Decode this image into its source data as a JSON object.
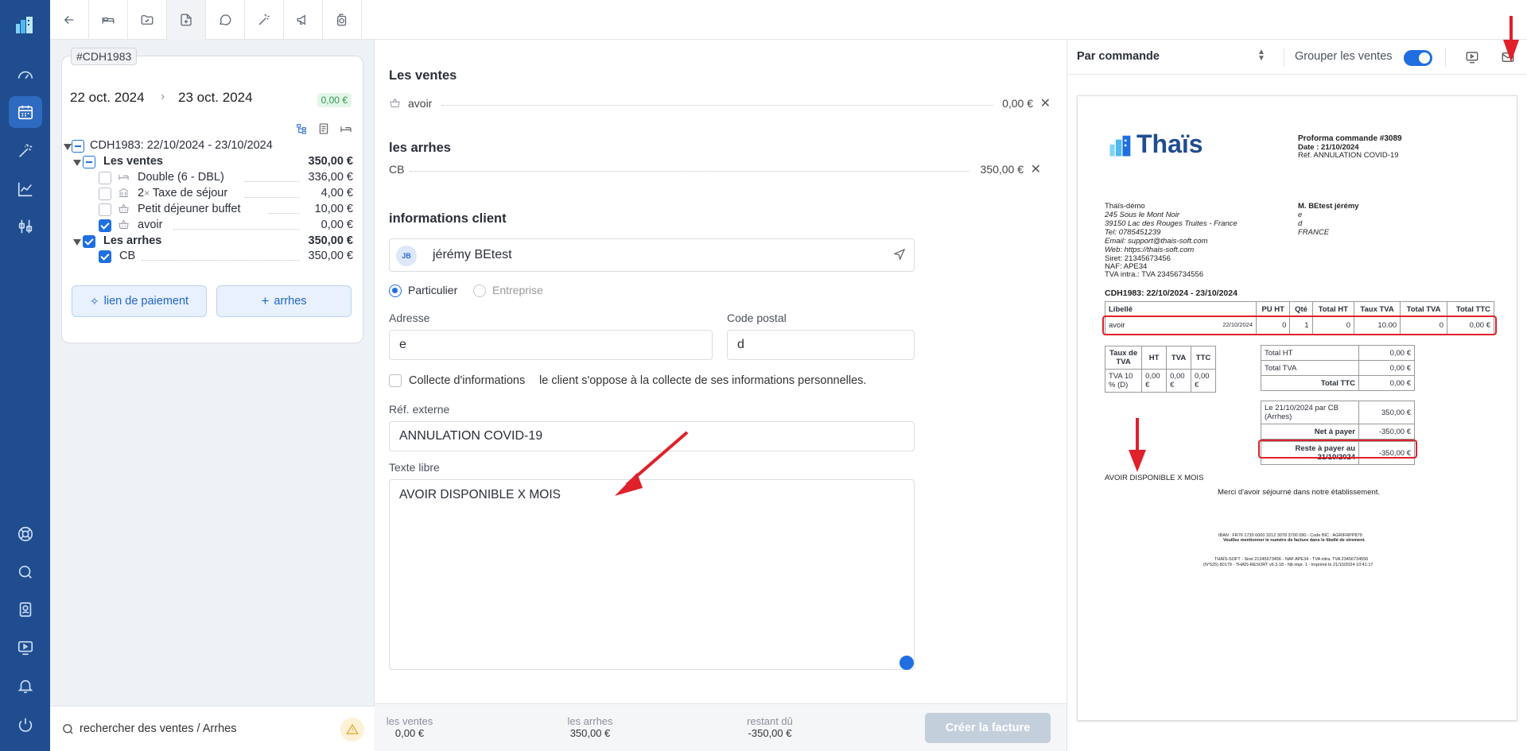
{
  "topbar": {
    "icons": [
      "back-arrow-icon",
      "bed-icon",
      "folder-open-icon",
      "document-plus-icon",
      "chat-icon",
      "magic-wand-icon",
      "megaphone-icon",
      "camera-icon"
    ]
  },
  "booking": {
    "id": "#CDH1983",
    "date_start": "22 oct. 2024",
    "date_end": "23 oct. 2024",
    "balance": "0,00 €"
  },
  "tree": {
    "root": "CDH1983: 22/10/2024 - 23/10/2024",
    "ventes": {
      "label": "Les ventes",
      "total": "350,00 €",
      "items": [
        {
          "label": "Double (6 - DBL)",
          "value": "336,00 €",
          "checked": false
        },
        {
          "qty": "2",
          "mult": "×",
          "label": "Taxe de séjour",
          "value": "4,00 €",
          "checked": false
        },
        {
          "label": "Petit déjeuner buffet",
          "value": "10,00 €",
          "checked": false
        },
        {
          "label": "avoir",
          "value": "0,00 €",
          "checked": true
        }
      ]
    },
    "arrhes": {
      "label": "Les arrhes",
      "total": "350,00 €",
      "items": [
        {
          "label": "CB",
          "value": "350,00 €",
          "checked": true
        }
      ]
    }
  },
  "buttons": {
    "payment_link": "lien de paiement",
    "add_arrhes": "arrhes",
    "create_invoice": "Créer la facture"
  },
  "search": {
    "placeholder": "rechercher des ventes / Arrhes"
  },
  "middle": {
    "ventes_title": "Les ventes",
    "vente_item": "avoir",
    "vente_value": "0,00 €",
    "arrhes_title": "les arrhes",
    "arrhes_item": "CB",
    "arrhes_value": "350,00 €",
    "client_title": "informations client",
    "client_initials": "JB",
    "client_name": "jérémy BEtest",
    "radio_particulier": "Particulier",
    "radio_entreprise": "Entreprise",
    "address_label": "Adresse",
    "address_value": "e",
    "postal_label": "Code postal",
    "postal_value": "d",
    "collect_label": "Collecte d'informations",
    "collect_text": "le client s'oppose à la collecte de ses informations personnelles.",
    "ref_label": "Réf. externe",
    "ref_value": "ANNULATION COVID-19",
    "free_label": "Texte libre",
    "free_value": "AVOIR DISPONIBLE X MOIS"
  },
  "footer": {
    "ventes_label": "les ventes",
    "ventes_value": "0,00 €",
    "arrhes_label": "les arrhes",
    "arrhes_value": "350,00 €",
    "due_label": "restant dû",
    "due_value": "-350,00 €"
  },
  "right": {
    "mode": "Par commande",
    "group_label": "Grouper les ventes",
    "group_on": true
  },
  "doc": {
    "logo": "Thaïs",
    "title": "Proforma commande #3089",
    "date": "Date : 21/10/2024",
    "ref": "Réf. ANNULATION COVID-19",
    "company": [
      "Thaïs-démo",
      "245 Sous le Mont Noir",
      "39150 Lac des Rouges Truites - France",
      "Tel: 0785451239",
      "Email: support@thais-soft.com",
      "Web: https://thais-soft.com",
      "Siret: 21345673456",
      "NAF: APE34",
      "TVA intra.: TVA 23456734556"
    ],
    "client": [
      "M. BEtest jérémy",
      "e",
      "d",
      "FRANCE"
    ],
    "booking_line": "CDH1983: 22/10/2024 - 23/10/2024",
    "table_headers": [
      "Libellé",
      "PU HT",
      "Qté",
      "Total HT",
      "Taux TVA",
      "Total TVA",
      "Total TTC"
    ],
    "table_row": {
      "label": "avoir",
      "date": "22/10/2024",
      "pu": "0",
      "qty": "1",
      "total_ht": "0",
      "rate": "10.00",
      "tva": "0",
      "ttc": "0,00 €"
    },
    "vat_headers": [
      "Taux de TVA",
      "HT",
      "TVA",
      "TTC"
    ],
    "vat_row": [
      "TVA 10 % (D)",
      "0,00 €",
      "0,00 €",
      "0,00 €"
    ],
    "totals": [
      {
        "k": "Total HT",
        "v": "0,00 €"
      },
      {
        "k": "Total TVA",
        "v": "0,00 €"
      },
      {
        "k": "Total TTC",
        "v": "0,00 €"
      }
    ],
    "payment": {
      "k": "Le 21/10/2024 par CB (Arrhes)",
      "v": "350,00 €"
    },
    "net": {
      "k": "Net à payer",
      "v": "-350,00 €"
    },
    "rest": {
      "k": "Reste à payer au 21/10/2024",
      "v": "-350,00 €"
    },
    "free_text": "AVOIR DISPONIBLE X MOIS",
    "thanks": "Merci d'avoir séjourné dans notre établissement.",
    "iban": "IBAN : FR76 1730 6000 3212 3078 3700 090 - Code BIC : AGRIFRPP879",
    "iban_note": "Veuillez mentionner le numéro de facture dans le libellé de virement.",
    "footer1": "THAÏS-SOFT - Siret 21345673456 - NAF APE34 - TVA intra. TVA 23456734556",
    "footer2": "(N°525) 80179 - THAÏS-RESORT v6.3.18 - Nb impr. 1 - Imprimé le 21/10/2024 10:41:17"
  },
  "colors": {
    "sidebar": "#1f4d8f",
    "accent": "#1f6fe0",
    "highlight": "#e0202a"
  }
}
